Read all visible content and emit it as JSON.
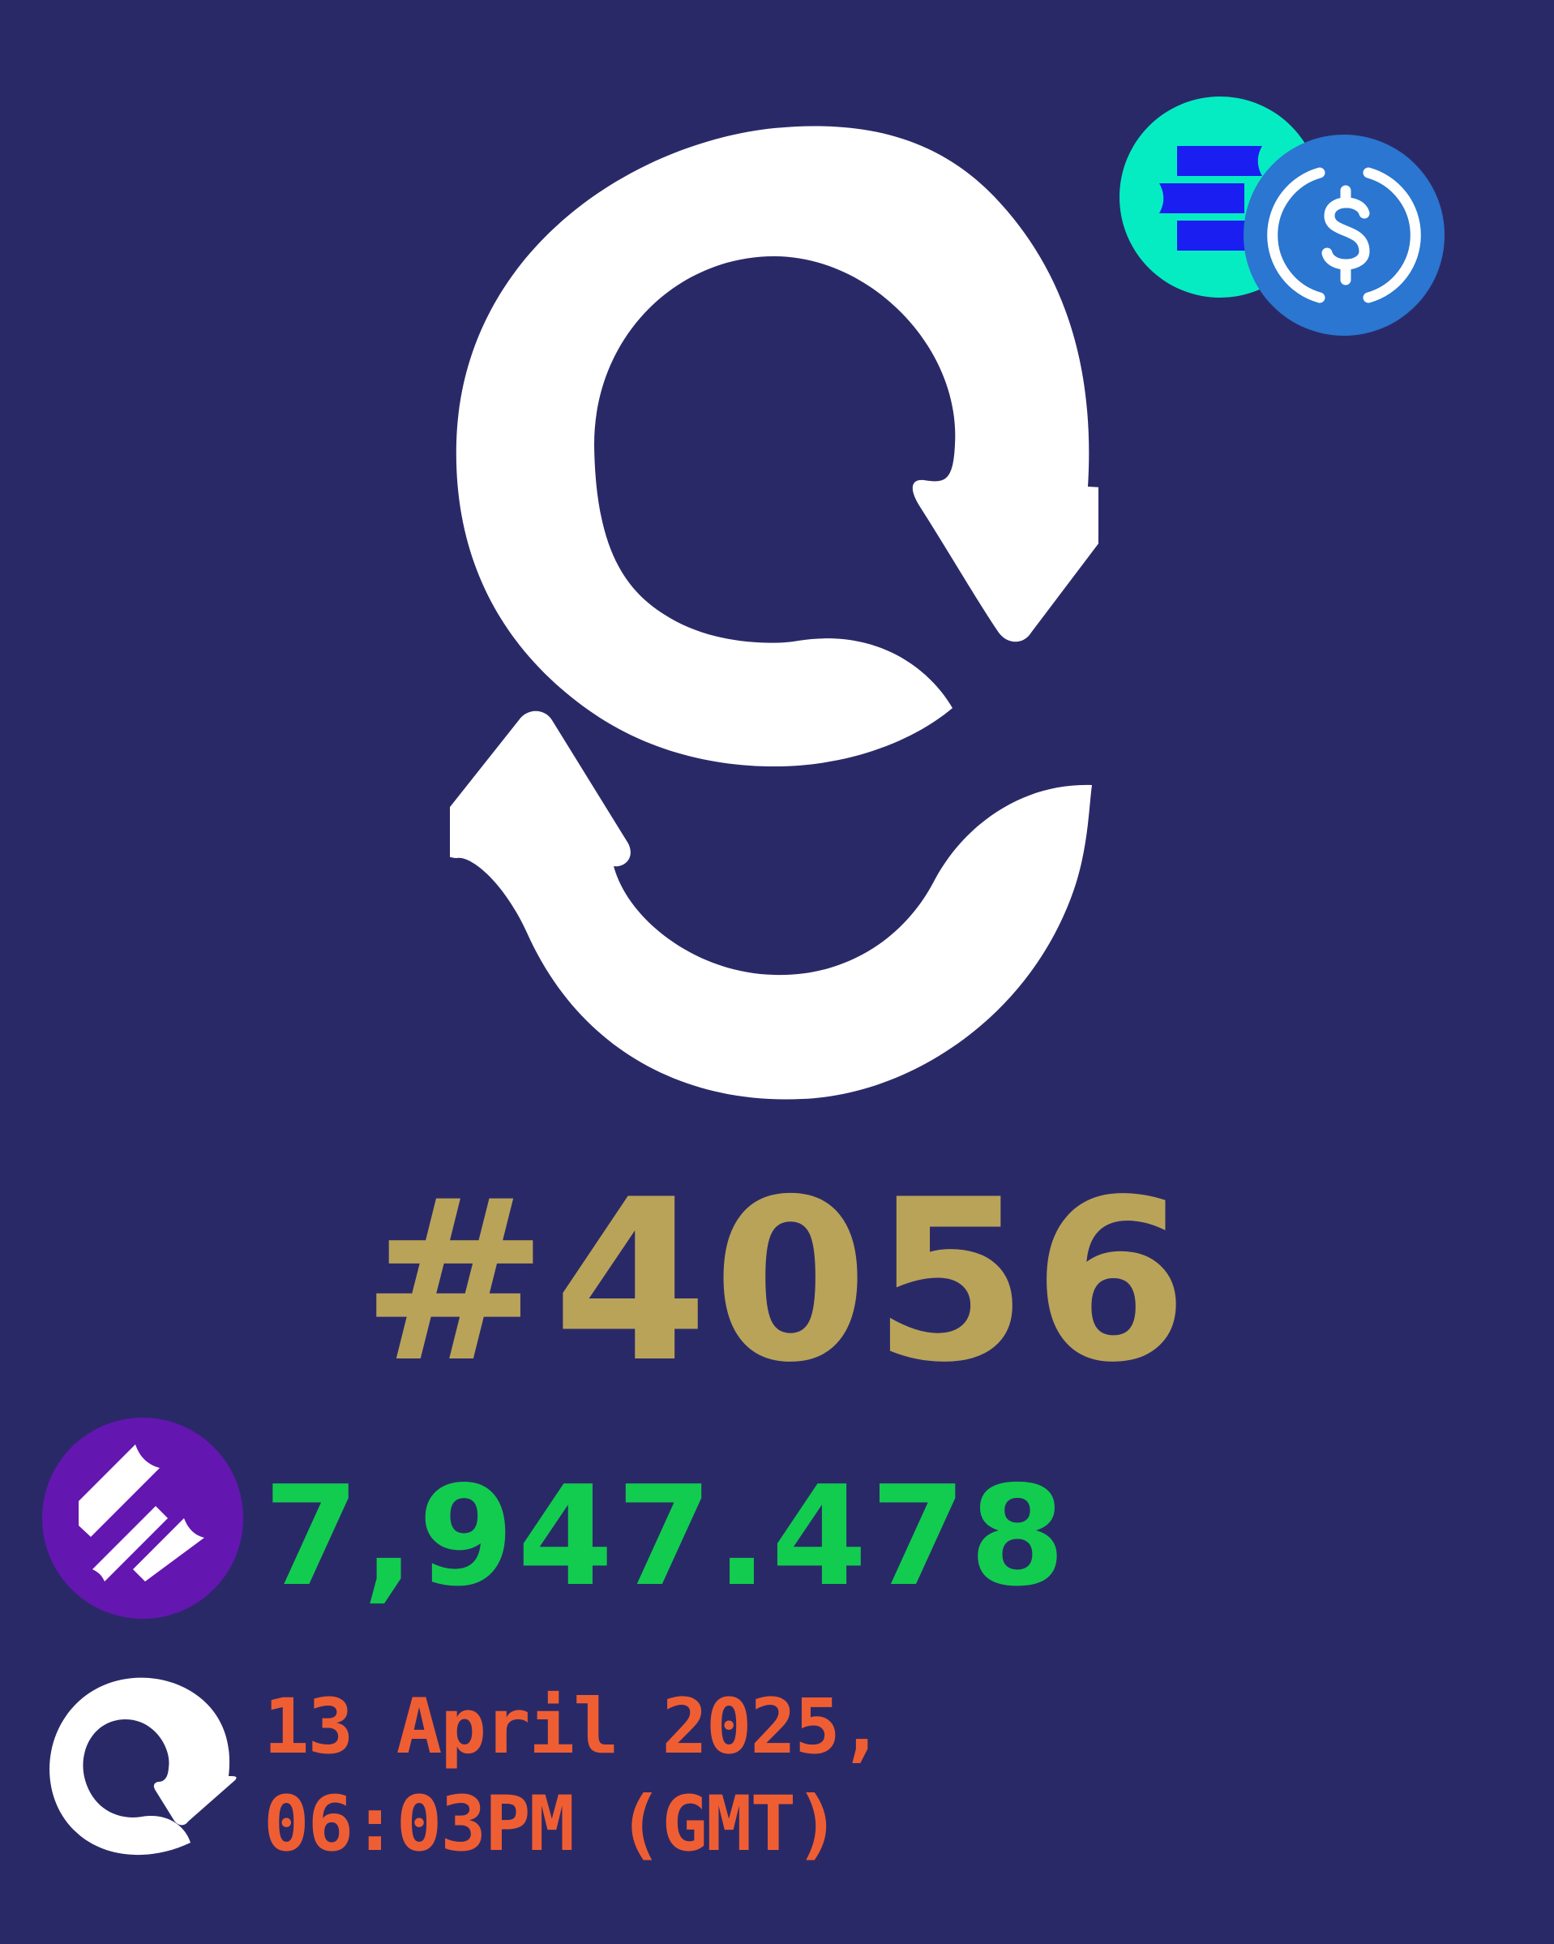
{
  "colors": {
    "background": "#2a2968",
    "id_number": "#b9a358",
    "amount": "#12cc4f",
    "timestamp": "#ef5e33",
    "logo": "#ffffff",
    "amount_badge": "#6416b1",
    "token_a_badge": "#05ecc3",
    "token_b_badge": "#2a76d0"
  },
  "icons": {
    "main_logo": "swap-arrows-logo-icon",
    "token_a": "stacked-bars-token-icon",
    "token_b": "dollar-coin-icon",
    "amount_token": "diagonal-bars-token-icon",
    "small_logo": "swap-arrow-icon"
  },
  "record": {
    "id_number": "#4056",
    "amount": "7,947.478",
    "timestamp_date": "13 April 2025,",
    "timestamp_time": "06:03PM (GMT)"
  }
}
